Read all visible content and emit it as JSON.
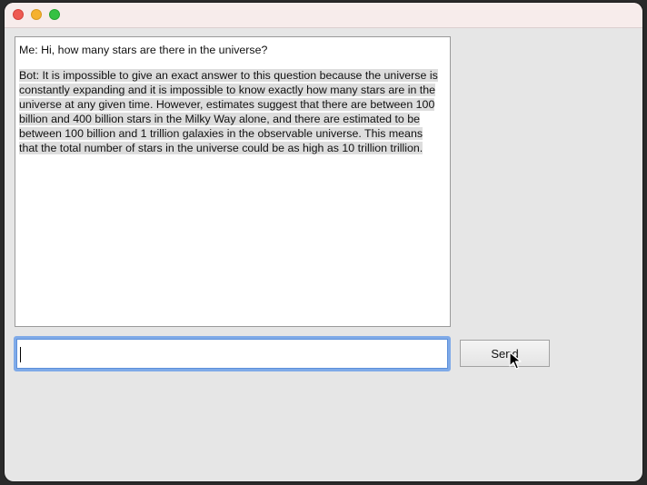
{
  "chat": {
    "user_message": "Me: Hi, how many stars are there in the universe?",
    "bot_message": "Bot: It is impossible to give an exact answer to this question because the universe is constantly expanding and it is impossible to know exactly how many stars are in the universe at any given time. However, estimates suggest that there are between 100 billion and 400 billion stars in the Milky Way alone, and there are estimated to be between 100 billion and 1 trillion galaxies in the observable universe. This means that the total number of stars in the universe could be as high as 10 trillion trillion."
  },
  "input": {
    "value": "",
    "placeholder": ""
  },
  "send_button": {
    "label": "Send"
  },
  "colors": {
    "window_bg": "#e6e6e6",
    "titlebar_bg": "#f7eceb",
    "close": "#ee5a52",
    "minimize": "#f5b12e",
    "maximize": "#36c143",
    "focus_ring": "#7faae8",
    "bot_highlight": "#dddddd"
  },
  "icons": {
    "close": "close-icon",
    "minimize": "minimize-icon",
    "maximize": "maximize-icon",
    "mouse_cursor": "arrow-cursor-icon"
  }
}
